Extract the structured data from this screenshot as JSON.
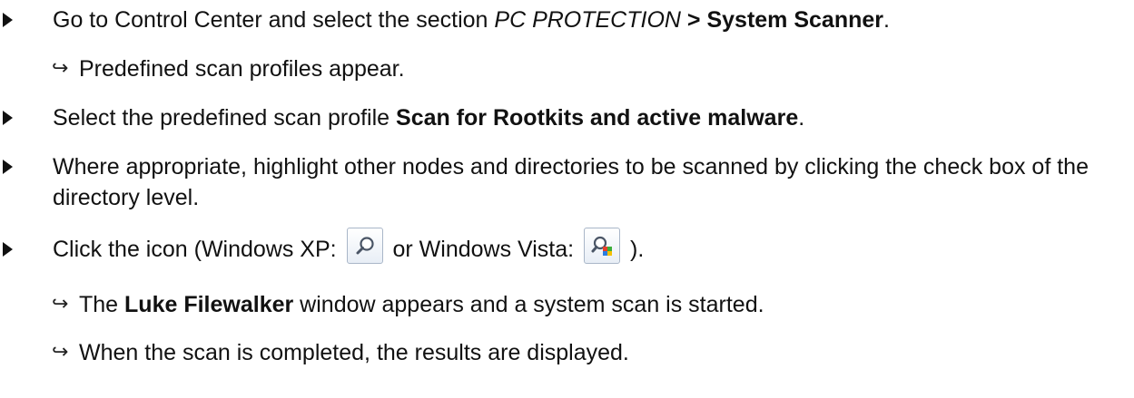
{
  "steps": [
    {
      "parts": [
        "Go to Control Center and select the section ",
        "PC PROTECTION",
        " > ",
        "System Scanner",
        "."
      ]
    },
    {
      "result": "Predefined scan profiles appear."
    },
    {
      "parts": [
        "Select the predefined scan profile ",
        "Scan for Rootkits and active malware",
        "."
      ]
    },
    {
      "text": "Where appropriate, highlight other nodes and directories to be scanned by clicking the check box of the directory level."
    },
    {
      "parts": [
        "Click the icon (Windows XP: ",
        " or Windows Vista: ",
        " )."
      ],
      "icons": [
        "magnifier-icon",
        "magnifier-color-icon"
      ]
    },
    {
      "result_parts": [
        "The ",
        "Luke Filewalker",
        " window appears and a system scan is started."
      ]
    },
    {
      "result": "When the scan is completed, the results are displayed."
    }
  ],
  "result_arrow": "↪",
  "colors": {
    "text": "#111111",
    "icon_border": "#a9b6c8"
  }
}
